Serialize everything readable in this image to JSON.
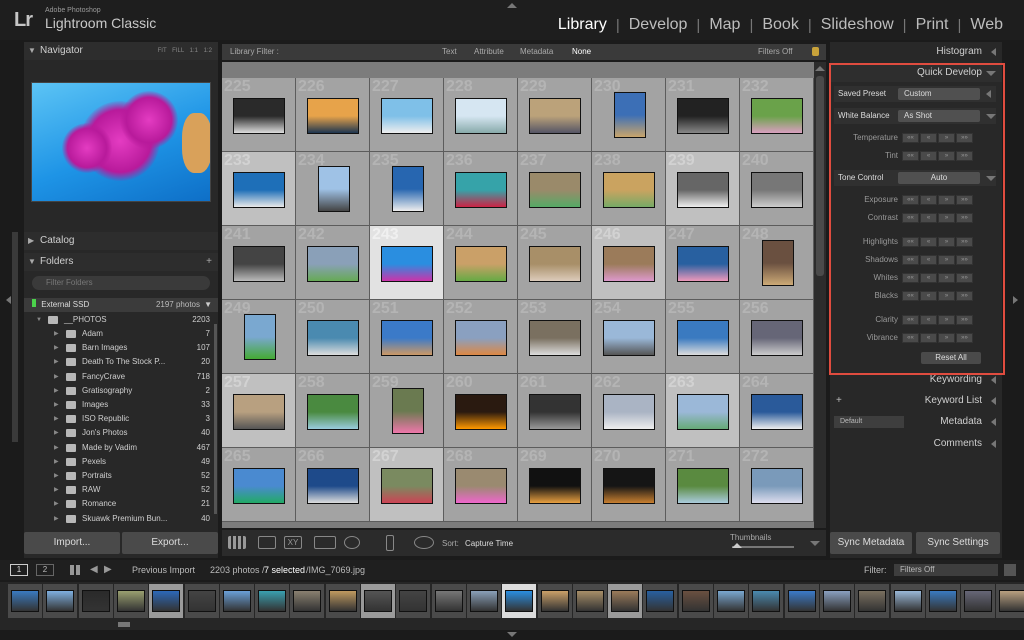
{
  "app": {
    "logo": "Lr",
    "brand_small": "Adobe Photoshop",
    "brand_big": "Lightroom Classic"
  },
  "modules": [
    {
      "label": "Library",
      "active": true
    },
    {
      "label": "Develop",
      "active": false
    },
    {
      "label": "Map",
      "active": false
    },
    {
      "label": "Book",
      "active": false
    },
    {
      "label": "Slideshow",
      "active": false
    },
    {
      "label": "Print",
      "active": false
    },
    {
      "label": "Web",
      "active": false
    }
  ],
  "left": {
    "navigator": {
      "title": "Navigator",
      "zoom": [
        "FIT",
        "FILL",
        "1:1",
        "1:2"
      ]
    },
    "catalog": {
      "title": "Catalog"
    },
    "folders": {
      "title": "Folders",
      "filter_placeholder": "Filter Folders",
      "drive": {
        "name": "External SSD",
        "count": "2197 photos"
      },
      "root": {
        "name": "__PHOTOS",
        "count": "2203"
      },
      "items": [
        {
          "name": "Adam",
          "count": "7"
        },
        {
          "name": "Barn Images",
          "count": "107"
        },
        {
          "name": "Death To The Stock P...",
          "count": "20"
        },
        {
          "name": "FancyCrave",
          "count": "718"
        },
        {
          "name": "Gratisography",
          "count": "2"
        },
        {
          "name": "Images",
          "count": "33"
        },
        {
          "name": "ISO Republic",
          "count": "3"
        },
        {
          "name": "Jon's Photos",
          "count": "40"
        },
        {
          "name": "Made by Vadim",
          "count": "467"
        },
        {
          "name": "Pexels",
          "count": "49"
        },
        {
          "name": "Portraits",
          "count": "52"
        },
        {
          "name": "RAW",
          "count": "52"
        },
        {
          "name": "Romance",
          "count": "21"
        },
        {
          "name": "Skuawk Premium Bun...",
          "count": "40"
        }
      ]
    },
    "import_label": "Import...",
    "export_label": "Export..."
  },
  "filterbar": {
    "label": "Library Filter :",
    "tabs": [
      "Text",
      "Attribute",
      "Metadata",
      "None"
    ],
    "status": "Filters Off"
  },
  "grid": {
    "numbers": [
      225,
      226,
      227,
      228,
      229,
      230,
      231,
      232,
      233,
      234,
      235,
      236,
      237,
      238,
      239,
      240,
      241,
      242,
      243,
      244,
      245,
      246,
      247,
      248,
      249,
      250,
      251,
      252,
      253,
      254,
      255,
      256,
      257,
      258,
      259,
      260,
      261,
      262,
      263,
      264,
      265,
      266,
      267,
      268,
      269,
      270,
      271,
      272
    ],
    "selected": [
      233,
      239,
      243,
      246,
      257,
      263,
      267
    ],
    "current": 243
  },
  "toolbar": {
    "sort_label": "Sort:",
    "sort_value": "Capture Time",
    "thumbs_label": "Thumbnails"
  },
  "right": {
    "histogram": "Histogram",
    "quick_develop": {
      "title": "Quick Develop",
      "saved_preset": {
        "label": "Saved Preset",
        "value": "Custom"
      },
      "white_balance": {
        "label": "White Balance",
        "value": "As Shot"
      },
      "wb_sliders": [
        "Temperature",
        "Tint"
      ],
      "tone_control": {
        "label": "Tone Control",
        "button": "Auto"
      },
      "tone_sliders": [
        "Exposure",
        "Contrast",
        "Highlights",
        "Shadows",
        "Whites",
        "Blacks",
        "Clarity",
        "Vibrance"
      ],
      "reset": "Reset All"
    },
    "keywording": "Keywording",
    "keyword_list": "Keyword List",
    "metadata": {
      "title": "Metadata",
      "preset": "Default"
    },
    "comments": "Comments",
    "sync_metadata": "Sync Metadata",
    "sync_settings": "Sync Settings"
  },
  "filmbar": {
    "pages": [
      "1",
      "2"
    ],
    "source": "Previous Import",
    "count": "2203 photos /",
    "selected": "7 selected",
    "file": "/IMG_7069.jpg",
    "filter_label": "Filter:",
    "filter_value": "Filters Off"
  },
  "colors": {
    "highlight": "#e04c3f",
    "panel": "#282828",
    "grid_bg": "#7c7c7c"
  }
}
